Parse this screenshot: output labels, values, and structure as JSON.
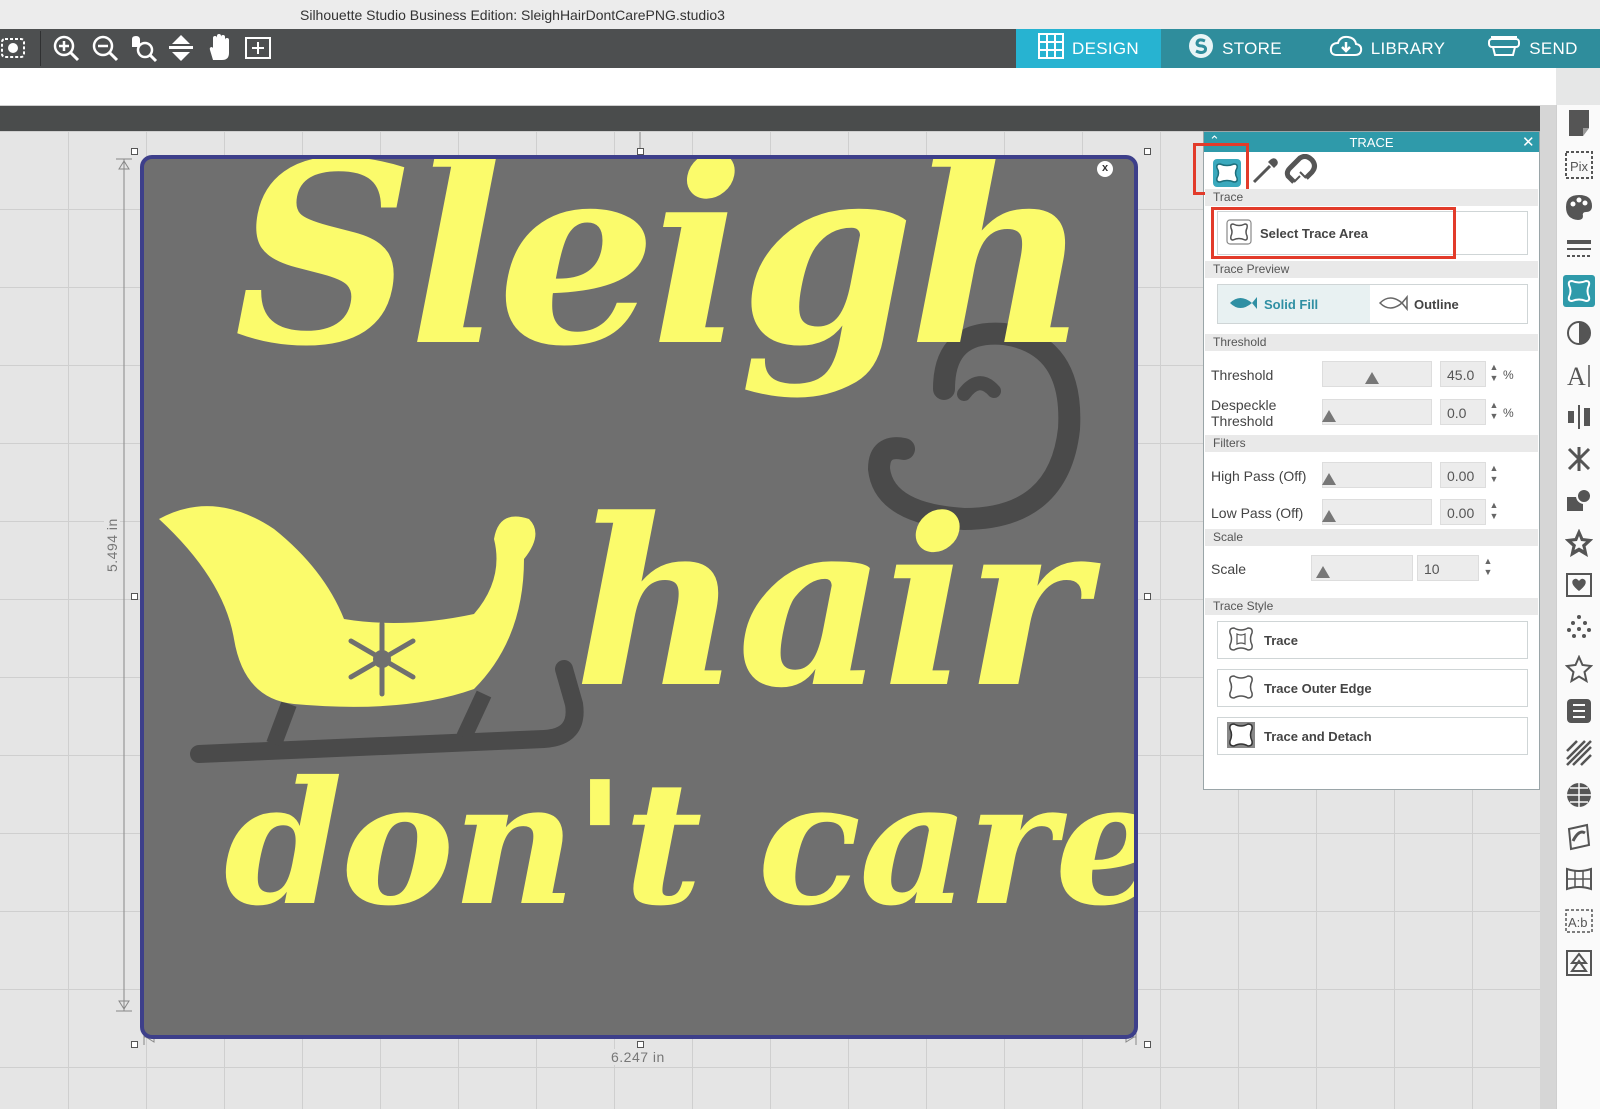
{
  "window": {
    "title": "Silhouette Studio Business Edition: SleighHairDontCarePNG.studio3"
  },
  "nav": {
    "design": "DESIGN",
    "store": "STORE",
    "library": "LIBRARY",
    "send": "SEND"
  },
  "canvas": {
    "height_label": "5.494 in",
    "width_label": "6.247 in",
    "design_lines": [
      "Sleigh",
      "hair",
      "don't care!"
    ],
    "close_label": "x"
  },
  "trace_panel": {
    "title": "TRACE",
    "sections": {
      "trace": "Trace",
      "preview": "Trace Preview",
      "threshold": "Threshold",
      "filters": "Filters",
      "scale": "Scale",
      "style": "Trace Style"
    },
    "select_area": "Select Trace Area",
    "preview_solid": "Solid Fill",
    "preview_outline": "Outline",
    "threshold_label": "Threshold",
    "threshold_value": "45.0",
    "threshold_level": 0.45,
    "despeckle_label_1": "Despeckle",
    "despeckle_label_2": "Threshold",
    "despeckle_value": "0.0",
    "high_pass_label": "High Pass (Off)",
    "high_pass_value": "0.00",
    "low_pass_label": "Low Pass (Off)",
    "low_pass_value": "0.00",
    "scale_label": "Scale",
    "scale_value": "10",
    "percent": "%",
    "style_trace": "Trace",
    "style_outer": "Trace Outer Edge",
    "style_detach": "Trace and Detach"
  },
  "colors": {
    "accent": "#27b3d1",
    "panel_header": "#2f9aaa",
    "design_bg": "#6f6f6f",
    "lettering": "#fbfb6b",
    "highlight": "#e23b2a"
  }
}
